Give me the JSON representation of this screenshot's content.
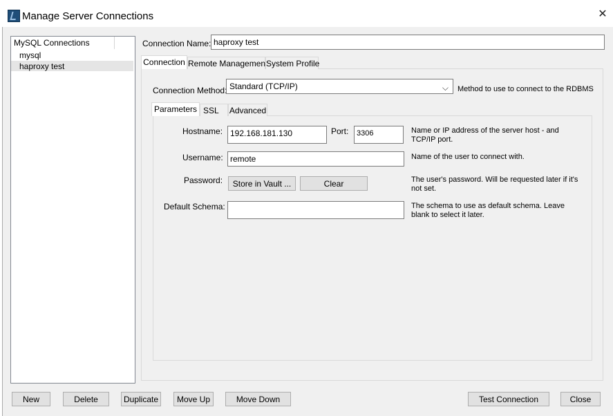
{
  "window": {
    "title": "Manage Server Connections",
    "close_glyph": "✕",
    "app_icon": "mysql-workbench-icon"
  },
  "connections": {
    "header": "MySQL Connections",
    "items": [
      {
        "label": "mysql"
      },
      {
        "label": "haproxy test",
        "selected": true
      }
    ]
  },
  "connection_name": {
    "label": "Connection Name:",
    "value": "haproxy test"
  },
  "tabs": [
    {
      "label": "Connection",
      "active": true
    },
    {
      "label": "Remote Management"
    },
    {
      "label": "System Profile"
    }
  ],
  "method": {
    "label": "Connection Method:",
    "value": "Standard (TCP/IP)",
    "help": "Method to use to connect to the RDBMS"
  },
  "subtabs": [
    {
      "label": "Parameters",
      "active": true
    },
    {
      "label": "SSL"
    },
    {
      "label": "Advanced"
    }
  ],
  "params": {
    "hostname_label": "Hostname:",
    "hostname_value": "192.168.181.130",
    "port_label": "Port:",
    "port_value": "3306",
    "hostname_help": "Name or IP address of the server host - and TCP/IP port.",
    "username_label": "Username:",
    "username_value": "remote",
    "username_help": "Name of the user to connect with.",
    "password_label": "Password:",
    "store_vault_label": "Store in Vault ...",
    "clear_label": "Clear",
    "password_help": "The user's password. Will be requested later if it's not set.",
    "schema_label": "Default Schema:",
    "schema_value": "",
    "schema_help": "The schema to use as default schema. Leave blank to select it later."
  },
  "footer": {
    "new_label": "New",
    "delete_label": "Delete",
    "duplicate_label": "Duplicate",
    "moveup_label": "Move Up",
    "movedown_label": "Move Down",
    "test_label": "Test Connection",
    "close_label": "Close"
  },
  "colors": {
    "window_bg": "#f0f0f0",
    "button_bg": "#e1e1e1",
    "selection_bg": "#e5e5e5"
  }
}
